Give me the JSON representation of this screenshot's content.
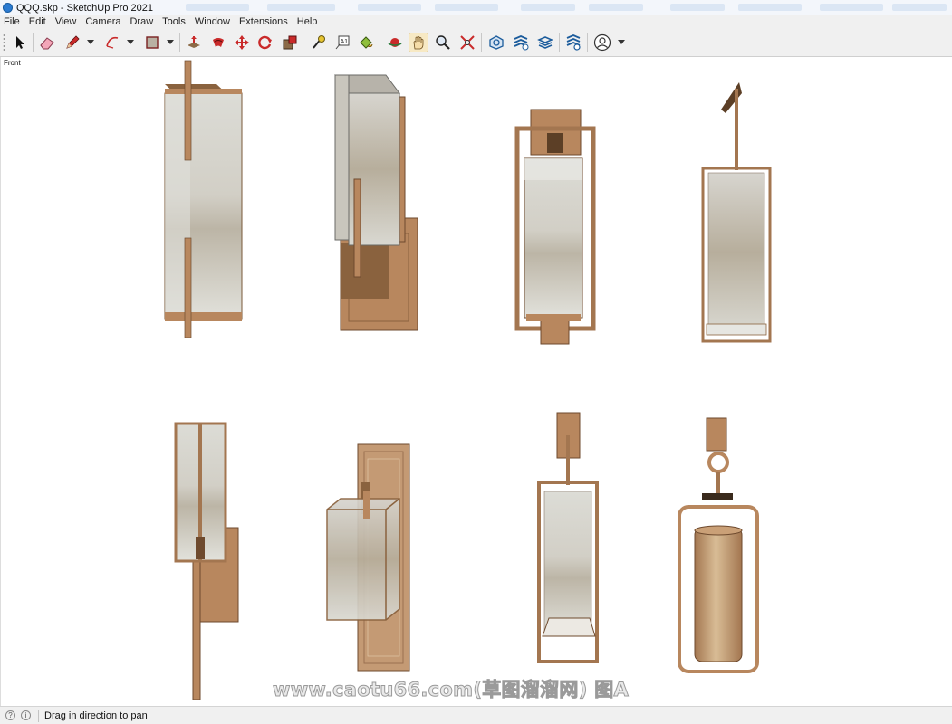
{
  "window": {
    "title": "QQQ.skp - SketchUp Pro 2021"
  },
  "menu": [
    "File",
    "Edit",
    "View",
    "Camera",
    "Draw",
    "Tools",
    "Window",
    "Extensions",
    "Help"
  ],
  "toolbar": {
    "tools": [
      "select-icon",
      "eraser-icon",
      "pencil-icon",
      "arc-icon",
      "rectangle-icon",
      "push-pull-icon",
      "follow-me-icon",
      "move-icon",
      "rotate-icon",
      "scale-icon",
      "tape-measure-icon",
      "text-icon",
      "paint-bucket-icon",
      "orbit-icon",
      "pan-icon",
      "zoom-icon",
      "zoom-extents-icon",
      "warehouse-icon",
      "extension-warehouse-icon",
      "layout-icon",
      "extension-manager-icon",
      "account-icon"
    ],
    "active_tool": "pan-icon"
  },
  "viewport": {
    "scene_label": "Front",
    "watermark": "www.caotu66.com(草图溜溜网) 图A"
  },
  "status": {
    "text": "Drag in direction to pan"
  },
  "colors": {
    "bronze": "#b8875e",
    "bronze_dark": "#6e4a2e",
    "glass": "#d9d9d2",
    "active_tool_bg": "#f7e9c4"
  }
}
